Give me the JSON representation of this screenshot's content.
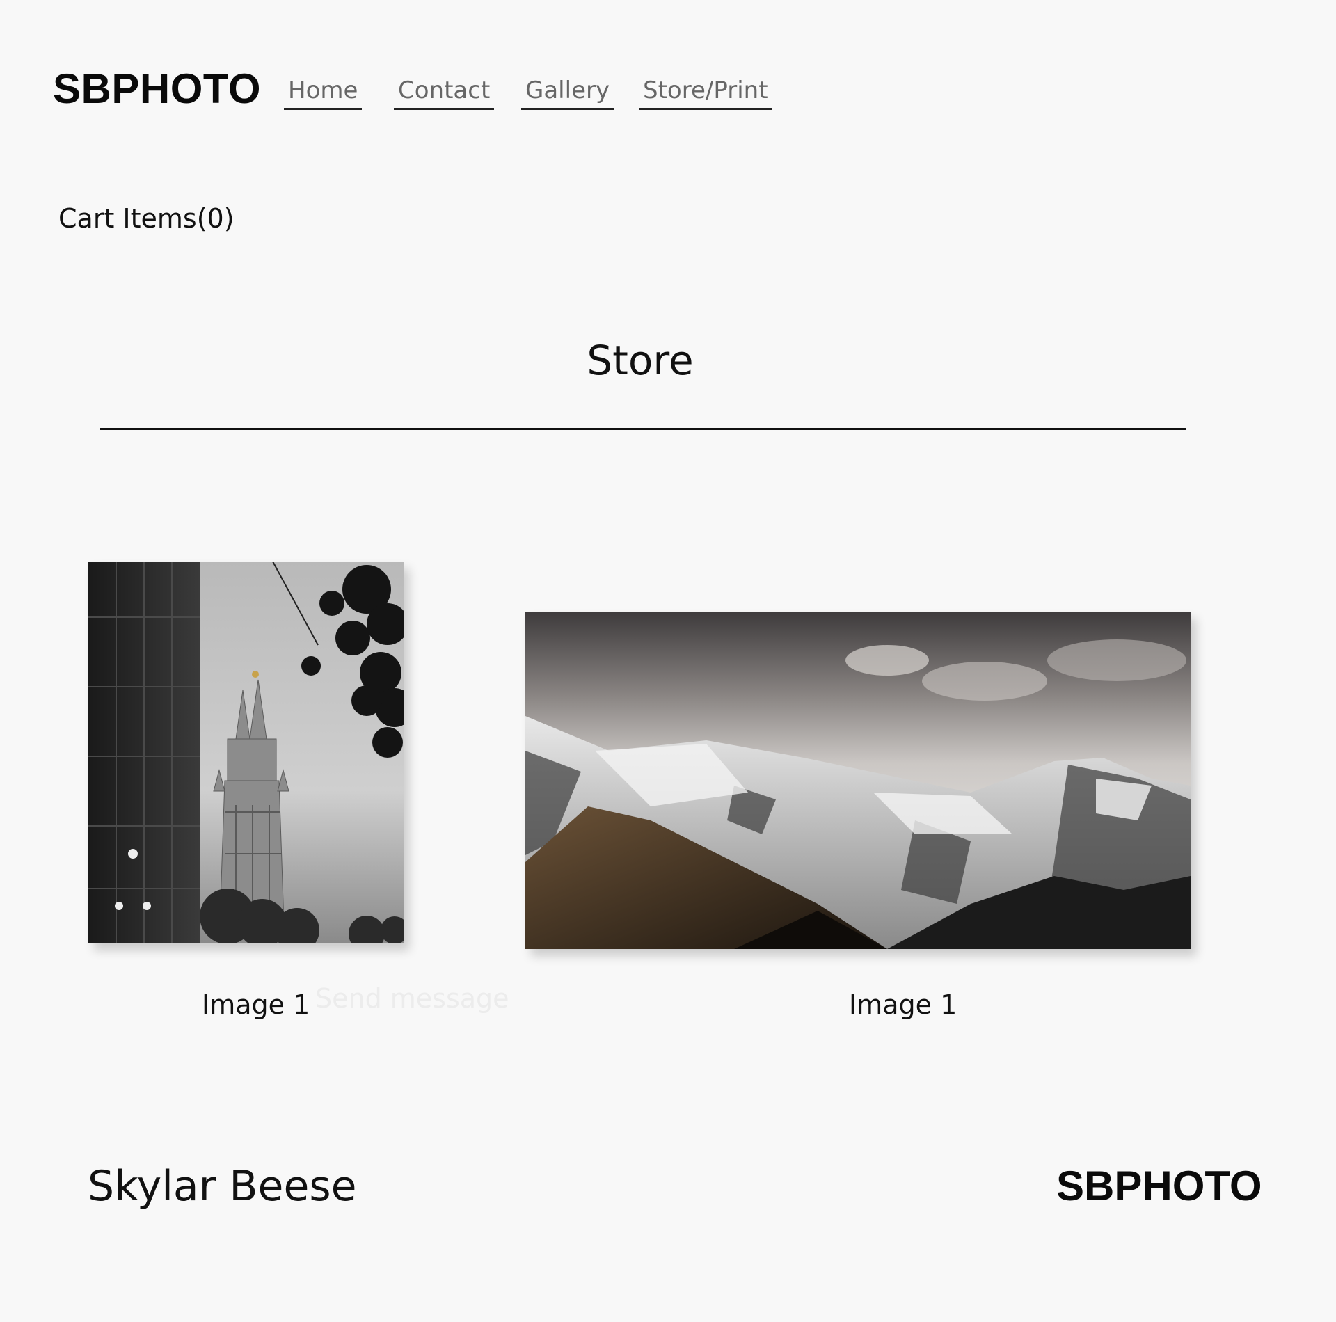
{
  "header": {
    "logo": "SBPHOTO",
    "nav": [
      {
        "label": "Home"
      },
      {
        "label": "Contact"
      },
      {
        "label": "Gallery"
      },
      {
        "label": "Store/Print"
      }
    ]
  },
  "cart": {
    "label": "Cart Items(0)"
  },
  "store": {
    "title": "Store",
    "items": [
      {
        "caption": "Image 1"
      },
      {
        "caption": "Image 1"
      }
    ],
    "ghost_text": "Send message"
  },
  "footer": {
    "name": "Skylar Beese",
    "logo": "SBPHOTO"
  }
}
